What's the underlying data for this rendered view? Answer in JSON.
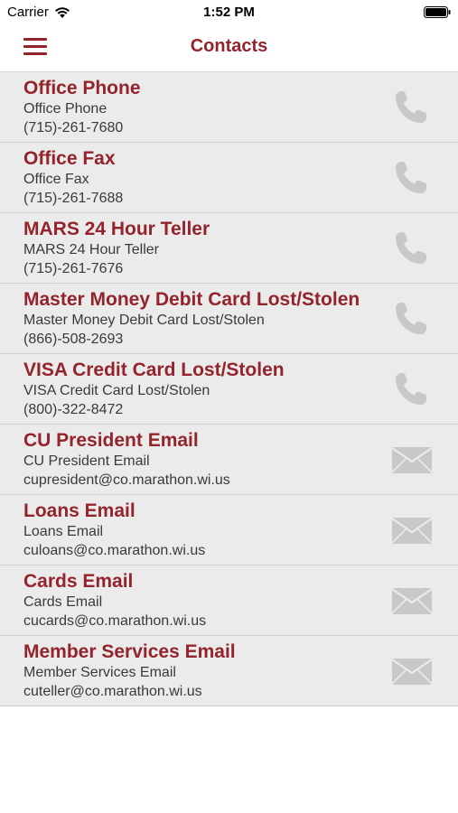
{
  "status_bar": {
    "carrier": "Carrier",
    "time": "1:52 PM",
    "wifi_icon": "wifi-icon",
    "battery_icon": "battery-icon"
  },
  "header": {
    "title": "Contacts",
    "menu_icon": "hamburger-menu-icon",
    "accent_color": "#94242b"
  },
  "contacts": [
    {
      "name": "Office Phone",
      "subtitle": "Office Phone",
      "value": "(715)-261-7680",
      "icon": "phone-icon"
    },
    {
      "name": "Office Fax",
      "subtitle": "Office Fax",
      "value": "(715)-261-7688",
      "icon": "phone-icon"
    },
    {
      "name": "MARS 24 Hour Teller",
      "subtitle": "MARS 24 Hour Teller",
      "value": "(715)-261-7676",
      "icon": "phone-icon"
    },
    {
      "name": "Master Money Debit Card Lost/Stolen",
      "subtitle": "Master Money Debit Card Lost/Stolen",
      "value": "(866)-508-2693",
      "icon": "phone-icon"
    },
    {
      "name": "VISA Credit Card Lost/Stolen",
      "subtitle": "VISA Credit Card Lost/Stolen",
      "value": "(800)-322-8472",
      "icon": "phone-icon"
    },
    {
      "name": "CU President Email",
      "subtitle": "CU President Email",
      "value": "cupresident@co.marathon.wi.us",
      "icon": "mail-icon"
    },
    {
      "name": "Loans Email",
      "subtitle": "Loans Email",
      "value": "culoans@co.marathon.wi.us",
      "icon": "mail-icon"
    },
    {
      "name": "Cards Email",
      "subtitle": "Cards Email",
      "value": "cucards@co.marathon.wi.us",
      "icon": "mail-icon"
    },
    {
      "name": "Member Services Email",
      "subtitle": "Member Services Email",
      "value": "cuteller@co.marathon.wi.us",
      "icon": "mail-icon"
    }
  ]
}
